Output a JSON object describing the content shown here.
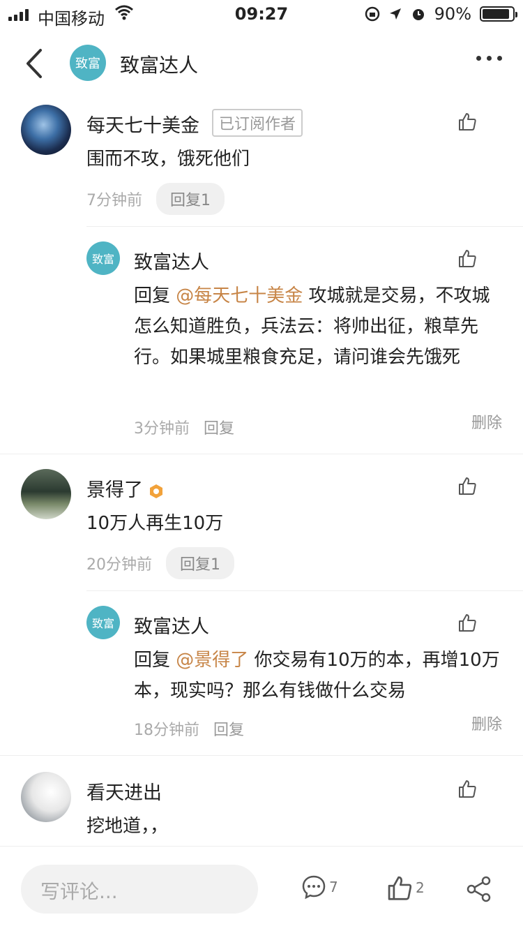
{
  "status": {
    "carrier": "中国移动",
    "time": "09:27",
    "battery": "90%",
    "battery_level": 0.9
  },
  "header": {
    "logo_text": "致富",
    "title": "致富达人",
    "icons": [
      "back-arrow-icon",
      "more-dots-icon"
    ]
  },
  "comments": [
    {
      "user": "每天七十美金",
      "tag": "已订阅作者",
      "text": "围而不攻，饿死他们",
      "time": "7分钟前",
      "reply_btn": "回复1",
      "reply": {
        "logo_text": "致富",
        "user": "致富达人",
        "prefix": "回复 ",
        "mention": "@每天七十美金",
        "text": " 攻城就是交易，不攻城怎么知道胜负，兵法云：将帅出征，粮草先行。如果城里粮食充足，请问谁会先饿死",
        "time": "3分钟前",
        "reply_btn": "回复",
        "delete": "删除"
      }
    },
    {
      "user": "景得了",
      "text": "10万人再生10万",
      "time": "20分钟前",
      "reply_btn": "回复1",
      "reply": {
        "logo_text": "致富",
        "user": "致富达人",
        "prefix": "回复 ",
        "mention": "@景得了",
        "text": " 你交易有10万的本，再增10万本，现实吗？那么有钱做什么交易",
        "time": "18分钟前",
        "reply_btn": "回复",
        "delete": "删除"
      }
    },
    {
      "user": "看天进出",
      "text": "挖地道，，"
    }
  ],
  "bottom": {
    "placeholder": "写评论...",
    "comment_count": "7",
    "like_count": "2"
  },
  "colors": {
    "accent": "#4fb4c4",
    "mention": "#c78547"
  }
}
